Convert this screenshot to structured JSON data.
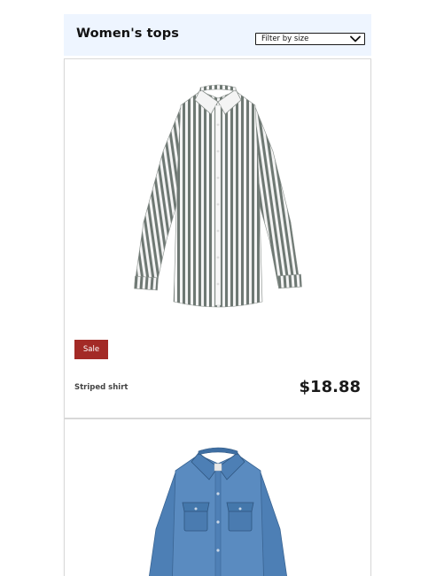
{
  "header": {
    "title": "Women's tops",
    "filter": {
      "selected_label": "Filter by size"
    }
  },
  "products": [
    {
      "name": "Striped shirt",
      "price": "$18.88",
      "badge": "Sale",
      "image_icon": "striped-shirt-icon",
      "colors": {
        "stripe": "#6e7873",
        "base": "#f4f4f4"
      }
    },
    {
      "image_icon": "denim-shirt-icon",
      "colors": {
        "denim": "#4d7fb5",
        "denim_dark": "#3a6594"
      }
    }
  ],
  "colors": {
    "header_bg": "#eef5ff",
    "sale_badge": "#a32a26",
    "card_border": "#d9d9d9"
  }
}
